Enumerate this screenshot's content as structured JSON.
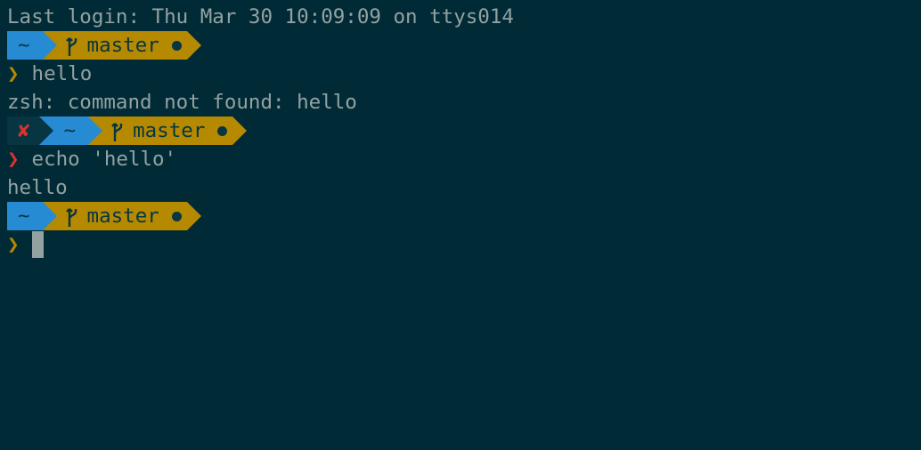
{
  "colors": {
    "background": "#002b36",
    "foreground": "#93a1a1",
    "dir_segment": "#268bd2",
    "git_segment": "#b58900",
    "status_segment": "#073642",
    "error": "#dc322f",
    "prompt_ok": "#b58900"
  },
  "login_line": "Last login: Thu Mar 30 10:09:09 on ttys014",
  "prompts": [
    {
      "dir": "~",
      "branch": "master",
      "branch_icon": "git-branch-icon",
      "dirty_icon": "dirty-dot-icon",
      "caret": "❯",
      "command": "hello",
      "output": "zsh: command not found: hello"
    },
    {
      "status_icon": "error-x-icon",
      "status": "✘",
      "dir": "~",
      "branch": "master",
      "branch_icon": "git-branch-icon",
      "dirty_icon": "dirty-dot-icon",
      "caret": "❯",
      "command": "echo 'hello'",
      "output": "hello"
    },
    {
      "dir": "~",
      "branch": "master",
      "branch_icon": "git-branch-icon",
      "dirty_icon": "dirty-dot-icon",
      "caret": "❯",
      "command": ""
    }
  ]
}
